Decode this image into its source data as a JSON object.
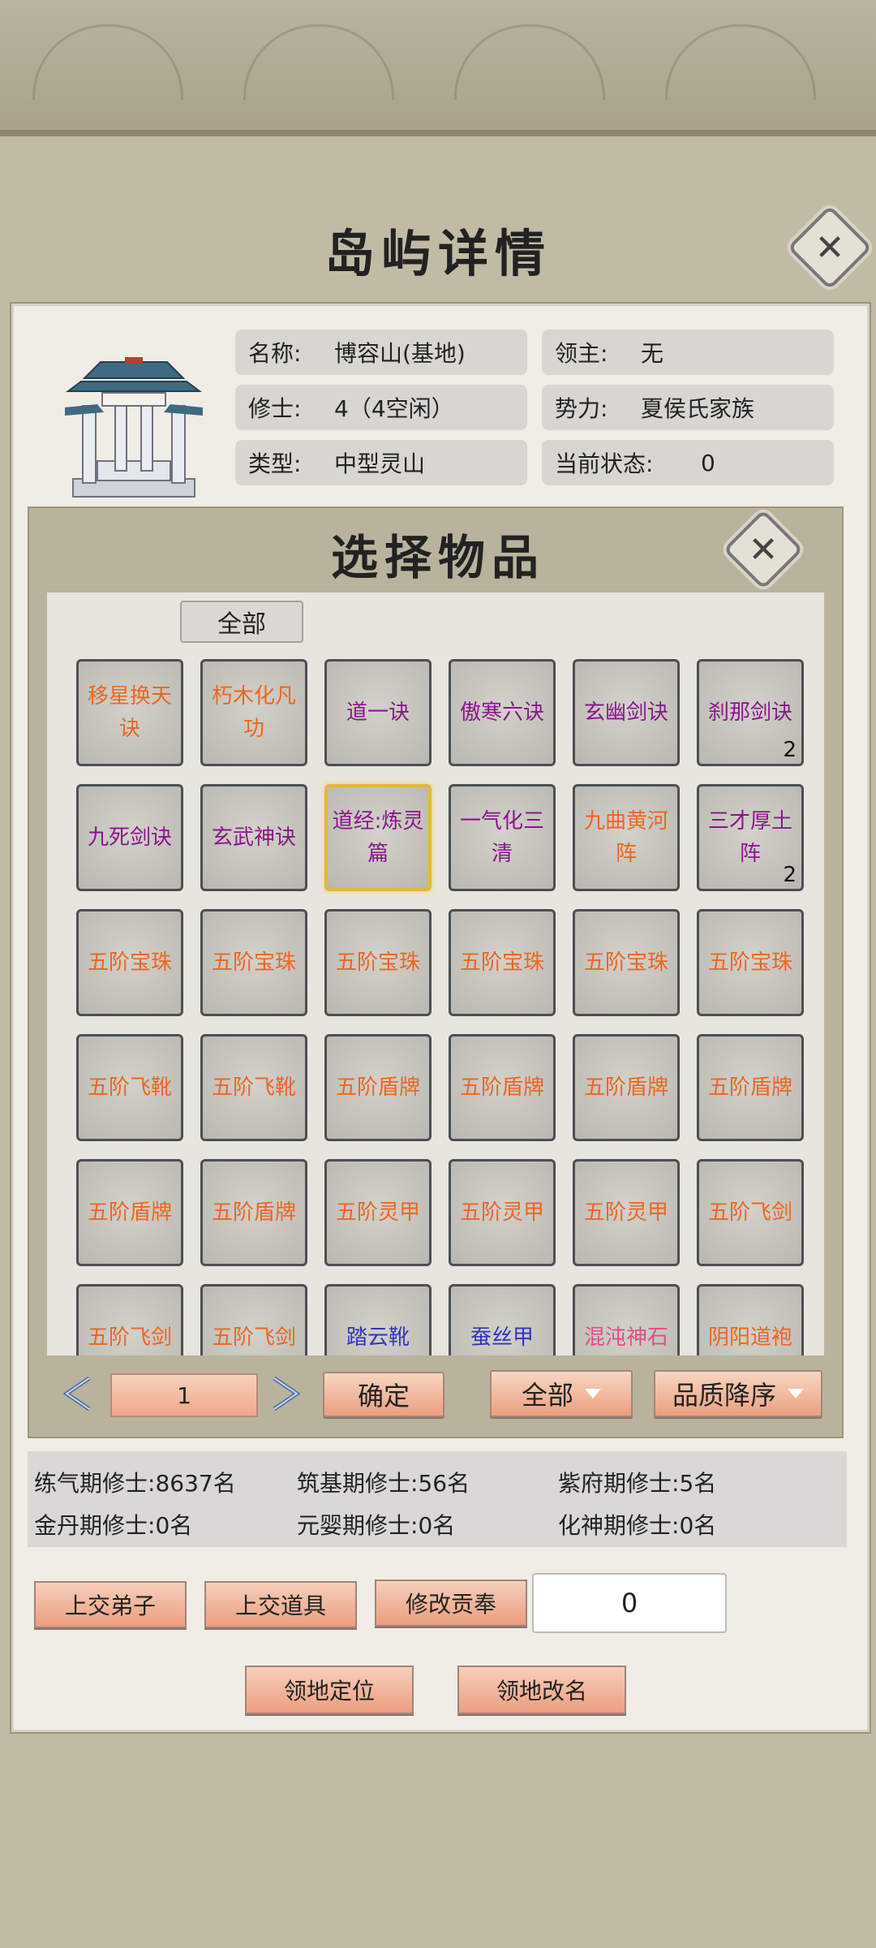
{
  "window": {
    "title": "岛屿详情",
    "close_icon": "close-icon"
  },
  "island": {
    "image_icon": "pavilion-gate-icon",
    "fields": [
      {
        "label": "名称:",
        "value": "博容山(基地)"
      },
      {
        "label": "领主:",
        "value": "无"
      },
      {
        "label": "修士:",
        "value": "4（4空闲）"
      },
      {
        "label": "势力:",
        "value": "夏侯氏家族"
      },
      {
        "label": "类型:",
        "value": "中型灵山"
      },
      {
        "label": "当前状态:",
        "value": "0"
      }
    ]
  },
  "modal": {
    "title": "选择物品",
    "filter_tab": "全部",
    "items": [
      {
        "name": "移星换天诀",
        "color": "#ee6522",
        "count": ""
      },
      {
        "name": "朽木化凡功",
        "color": "#ee6522",
        "count": ""
      },
      {
        "name": "道一诀",
        "color": "#8a168c",
        "count": ""
      },
      {
        "name": "傲寒六诀",
        "color": "#8a168c",
        "count": ""
      },
      {
        "name": "玄幽剑诀",
        "color": "#8a168c",
        "count": ""
      },
      {
        "name": "刹那剑诀",
        "color": "#8a168c",
        "count": "2"
      },
      {
        "name": "九死剑诀",
        "color": "#8a168c",
        "count": ""
      },
      {
        "name": "玄武神诀",
        "color": "#8a168c",
        "count": ""
      },
      {
        "name": "道经:炼灵篇",
        "color": "#8a168c",
        "count": "",
        "selected": true
      },
      {
        "name": "一气化三清",
        "color": "#8a168c",
        "count": ""
      },
      {
        "name": "九曲黄河阵",
        "color": "#ee6522",
        "count": ""
      },
      {
        "name": "三才厚土阵",
        "color": "#8a168c",
        "count": "2"
      },
      {
        "name": "五阶宝珠",
        "color": "#ee6522",
        "count": ""
      },
      {
        "name": "五阶宝珠",
        "color": "#ee6522",
        "count": ""
      },
      {
        "name": "五阶宝珠",
        "color": "#ee6522",
        "count": ""
      },
      {
        "name": "五阶宝珠",
        "color": "#ee6522",
        "count": ""
      },
      {
        "name": "五阶宝珠",
        "color": "#ee6522",
        "count": ""
      },
      {
        "name": "五阶宝珠",
        "color": "#ee6522",
        "count": ""
      },
      {
        "name": "五阶飞靴",
        "color": "#ee6522",
        "count": ""
      },
      {
        "name": "五阶飞靴",
        "color": "#ee6522",
        "count": ""
      },
      {
        "name": "五阶盾牌",
        "color": "#ee6522",
        "count": ""
      },
      {
        "name": "五阶盾牌",
        "color": "#ee6522",
        "count": ""
      },
      {
        "name": "五阶盾牌",
        "color": "#ee6522",
        "count": ""
      },
      {
        "name": "五阶盾牌",
        "color": "#ee6522",
        "count": ""
      },
      {
        "name": "五阶盾牌",
        "color": "#ee6522",
        "count": ""
      },
      {
        "name": "五阶盾牌",
        "color": "#ee6522",
        "count": ""
      },
      {
        "name": "五阶灵甲",
        "color": "#ee6522",
        "count": ""
      },
      {
        "name": "五阶灵甲",
        "color": "#ee6522",
        "count": ""
      },
      {
        "name": "五阶灵甲",
        "color": "#ee6522",
        "count": ""
      },
      {
        "name": "五阶飞剑",
        "color": "#ee6522",
        "count": ""
      },
      {
        "name": "五阶飞剑",
        "color": "#ee6522",
        "count": ""
      },
      {
        "name": "五阶飞剑",
        "color": "#ee6522",
        "count": ""
      },
      {
        "name": "踏云靴",
        "color": "#3336b8",
        "count": ""
      },
      {
        "name": "蚕丝甲",
        "color": "#3336b8",
        "count": ""
      },
      {
        "name": "混沌神石",
        "color": "#e64b86",
        "count": ""
      },
      {
        "name": "阴阳道袍",
        "color": "#ee6522",
        "count": ""
      }
    ],
    "pager": {
      "page": "1",
      "prev_icon": "chevron-left-icon",
      "next_icon": "chevron-right-icon"
    },
    "confirm_label": "确定",
    "category_dropdown": "全部",
    "sort_dropdown": "品质降序"
  },
  "stats": [
    {
      "label": "练气期修士:",
      "value": "8637名"
    },
    {
      "label": "筑基期修士:",
      "value": "56名"
    },
    {
      "label": "紫府期修士:",
      "value": "5名"
    },
    {
      "label": "金丹期修士:",
      "value": "0名"
    },
    {
      "label": "元婴期修士:",
      "value": "0名"
    },
    {
      "label": "化神期修士:",
      "value": "0名"
    }
  ],
  "actions": {
    "submit_disciple": "上交弟子",
    "submit_item": "上交道具",
    "edit_tribute": "修改贡奉",
    "tribute_value": "0",
    "locate": "领地定位",
    "rename": "领地改名"
  }
}
